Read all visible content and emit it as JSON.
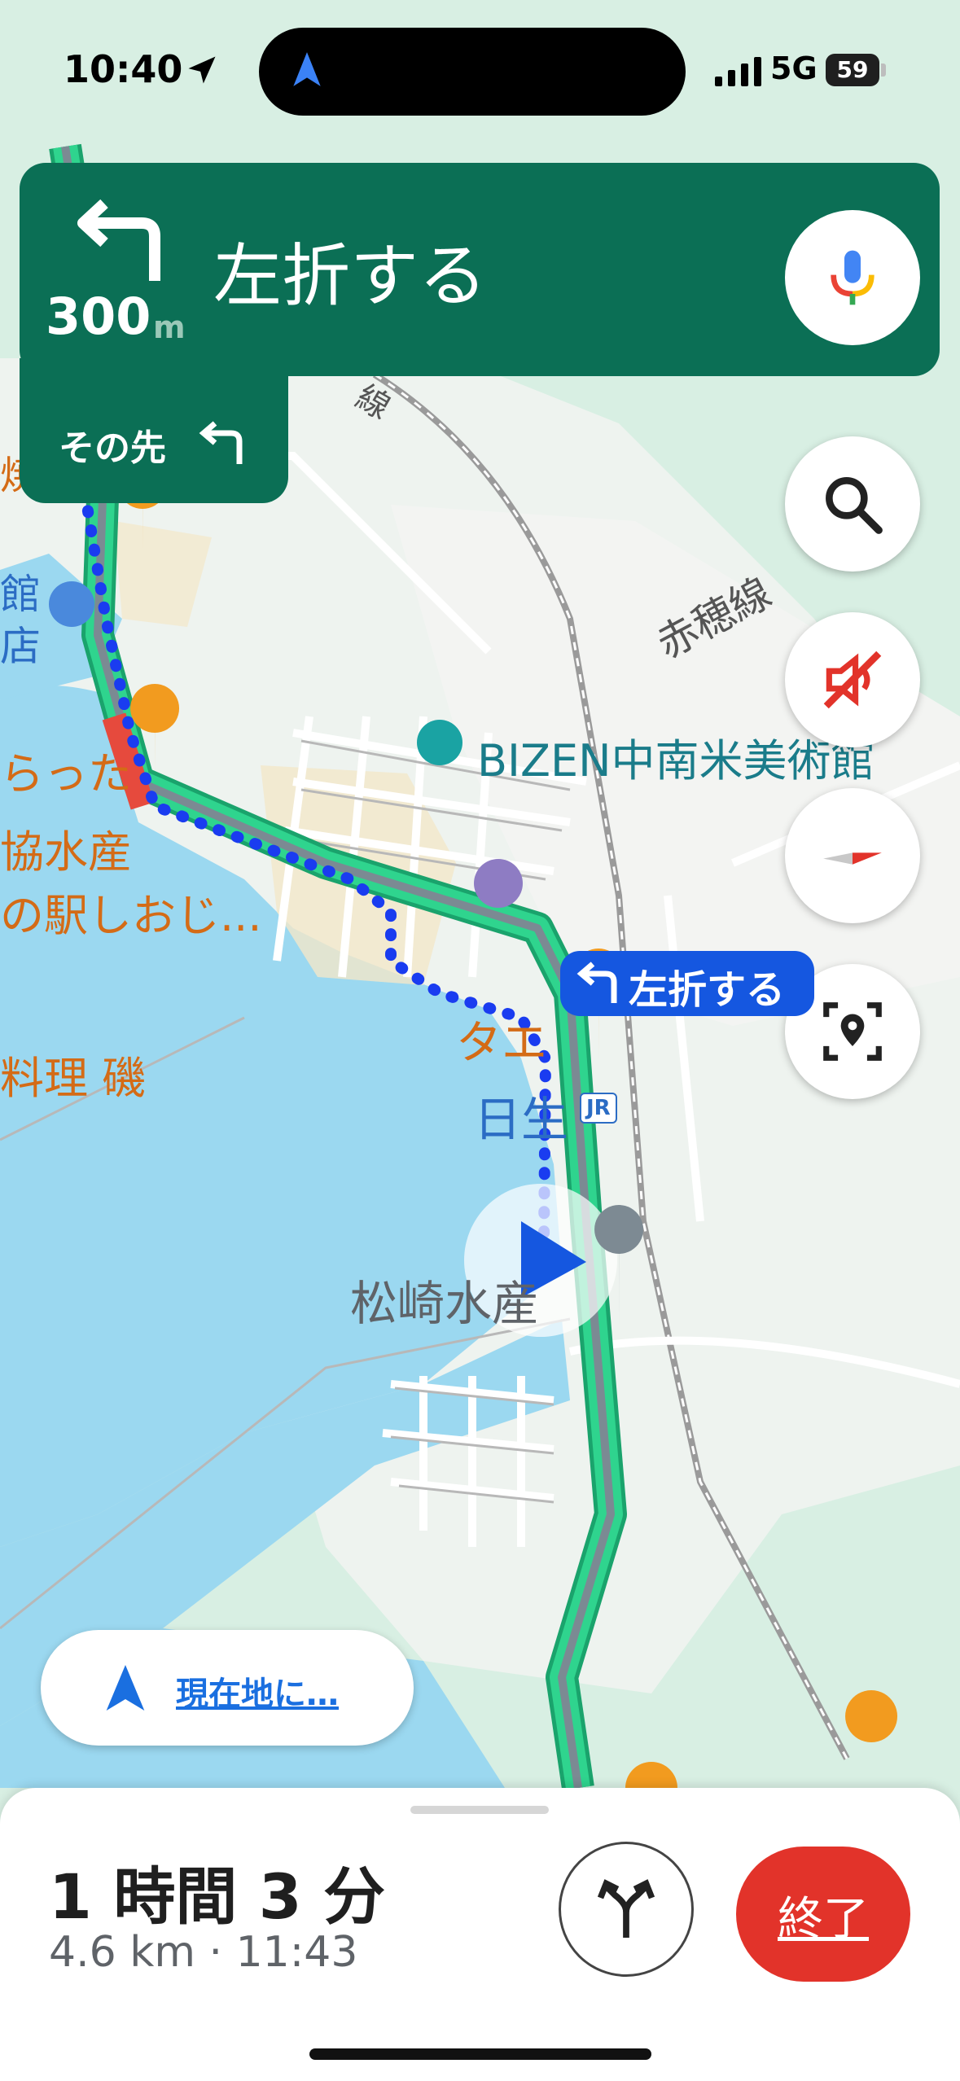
{
  "status_bar": {
    "time": "10:40",
    "network": "5G",
    "battery": "59"
  },
  "nav": {
    "distance": "300",
    "distance_unit": "m",
    "instruction": "左折する",
    "then_label": "その先",
    "callout": "左折する"
  },
  "map_labels": {
    "museum": "BIZEN中南米美術館",
    "railway": "赤穂線",
    "railway_partial": "線",
    "station": "日生",
    "jr_badge": "JR",
    "shop_seafood": "松崎水産",
    "left_1": "館",
    "left_2": "店",
    "left_3": "らった",
    "left_4": "協水産",
    "left_5": "の駅しおじ...",
    "left_6": "料理 磯",
    "left_7": "焼",
    "near_turn": "タエ"
  },
  "recenter_label": "現在地に…",
  "eta": {
    "duration": "1 時間 3 分",
    "distance_eta": "4.6 km · 11:43"
  },
  "end_button": "終了",
  "icons": {
    "location_arrow": "location-arrow-icon",
    "mic": "mic-icon",
    "search": "search-icon",
    "mute": "volume-off-icon",
    "compass": "compass-icon",
    "report": "report-location-icon",
    "alt_routes": "alternate-routes-icon"
  },
  "colors": {
    "banner": "#0b6f55",
    "route": "#2fd48e",
    "route_dots": "#1a3cf0",
    "callout": "#1557e0",
    "end": "#e2332a",
    "water": "#9bd8f0",
    "land": "#d8efe3"
  }
}
